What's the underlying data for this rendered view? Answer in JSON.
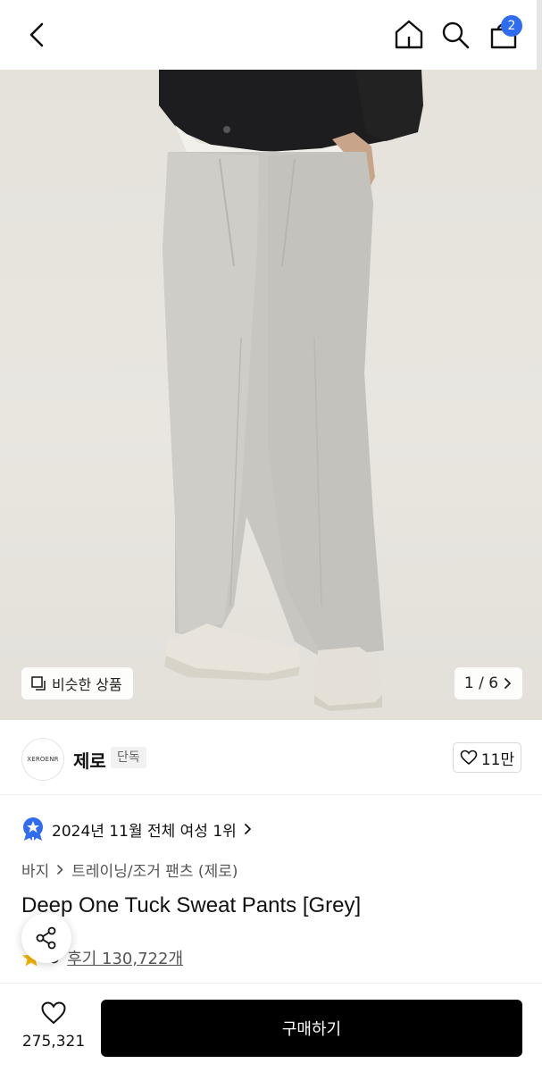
{
  "header": {
    "cart_count": "2",
    "icons": [
      "back-arrow-icon",
      "home-icon",
      "search-icon",
      "shopping-bag-icon"
    ],
    "badge_color": "#2f6cf0"
  },
  "gallery": {
    "similar_label": "비슷한 상품",
    "pager": "1 / 6"
  },
  "brand": {
    "logo_text": "XEROENR",
    "name": "제로",
    "tag": "단독",
    "likes": "11만"
  },
  "product": {
    "ranking": "2024년 11월 전체 여성 1위",
    "breadcrumb": [
      "바지",
      "트레이닝/조거 팬츠 (제로)"
    ],
    "title": "Deep One Tuck Sweat Pants [Grey]",
    "rating": ".9",
    "reviews": "후기 130,722개"
  },
  "bottom": {
    "wish_count": "275,321",
    "buy_label": "구매하기",
    "buy_color": "#000000"
  }
}
